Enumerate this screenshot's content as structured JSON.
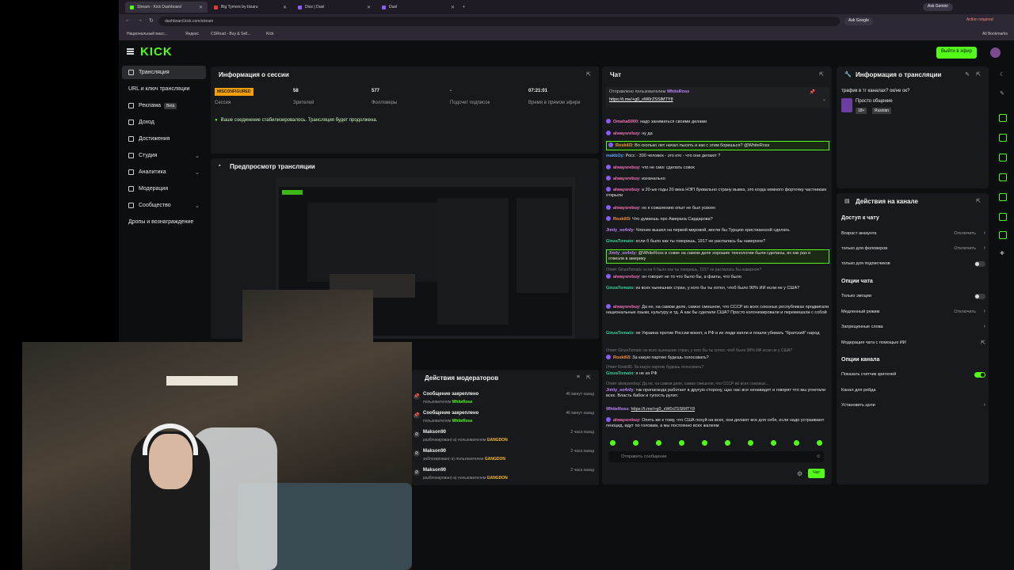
{
  "browser": {
    "tabs": [
      {
        "label": "Stream - Kick Dashboard",
        "active": true
      },
      {
        "label": "Big Tymers by bizaru",
        "active": false
      },
      {
        "label": "Dice | Duel",
        "active": false
      },
      {
        "label": "Duel",
        "active": false
      }
    ],
    "url": "dashboard.kick.com/stream",
    "bookmarks": [
      "Национальный масс...",
      "Яндекс",
      "CSRoad - Buy & Sell...",
      "Kick"
    ],
    "all_bookmarks": "All Bookmarks",
    "ask_search": "Ask Google",
    "gemini": "Ask Gemini",
    "action_required": "Action required"
  },
  "app": {
    "logo": "KICK",
    "go_live": "Выйти в эфир"
  },
  "sidebar": {
    "items": [
      {
        "label": "Трансляция",
        "active": true
      },
      {
        "label": "URL и ключ трансляции"
      },
      {
        "label": "Реклама",
        "badge": "Beta"
      },
      {
        "label": "Доход"
      },
      {
        "label": "Достижения"
      },
      {
        "label": "Студия",
        "expand": "⌄"
      },
      {
        "label": "Аналитика",
        "expand": "⌄"
      },
      {
        "label": "Модерация"
      },
      {
        "label": "Сообщество",
        "expand": "⌄"
      },
      {
        "label": "Дропы и вознаграждение"
      }
    ]
  },
  "session": {
    "title": "Информация о сессии",
    "badge": "MISCONFIGURED",
    "stats": [
      {
        "value": "",
        "label": "Сессия"
      },
      {
        "value": "58",
        "label": "Зрителей"
      },
      {
        "value": "577",
        "label": "Фолловеры"
      },
      {
        "value": "-",
        "label": "Подсчет подписок"
      },
      {
        "value": "07:21:01",
        "label": "Время в прямом эфире"
      }
    ],
    "stable_msg": "Ваше соединение стабилизировалось. Трансляция будет продолжена."
  },
  "preview": {
    "title": "Предпросмотр трансляции"
  },
  "mod_actions": {
    "title": "Действия модераторов",
    "rows": [
      {
        "title": "Сообщение закреплено",
        "sub": "пользователем",
        "user": "WhiteRoss",
        "time": "46 минут назад",
        "icon": "pin-icon"
      },
      {
        "title": "Сообщение закреплено",
        "sub": "пользователем",
        "user": "WhiteRoss",
        "time": "46 минут назад",
        "icon": "pin-icon"
      },
      {
        "title": "Makson90",
        "sub": "разблокирован(-а) пользователем",
        "user": "GANGDON",
        "time": "2 часа назад",
        "icon": "unban-icon"
      },
      {
        "title": "Makson90",
        "sub": "заблокирован(-а) пользователем",
        "user": "GANGDON",
        "time": "2 часа назад",
        "icon": "ban-icon"
      },
      {
        "title": "Makson90",
        "sub": "разблокирован(-а) пользователем",
        "user": "GANGDON",
        "time": "2 часа назад",
        "icon": "unban-icon"
      }
    ]
  },
  "chat": {
    "title": "Чат",
    "pinned_by": "Отправлено пользователем",
    "pinned_user": "WhiteRoss",
    "pinned_link": "https://t.me/+g0_xW0rZSSlMTY8",
    "input_placeholder": "Отправить сообщение",
    "send_label": "Чат",
    "messages": [
      {
        "user": "Omaha5000",
        "text": "надо заниматься своими делами",
        "color": "u-pink"
      },
      {
        "user": "alwaysrebuy",
        "text": "ну да",
        "color": "u-pink"
      },
      {
        "user": "Roskill3",
        "text": "Во сколько лет начал лысеть и как с этим боришься? @WhiteRoss",
        "color": "u-orange",
        "highlight": true
      },
      {
        "user": "makbOy",
        "text": "Росс - 300 человек - это кто - что они делают ?",
        "color": "u-blue"
      },
      {
        "user": "alwaysrebuy",
        "text": "что не смог сделать совок",
        "color": "u-pink"
      },
      {
        "user": "alwaysrebuy",
        "text": "изначально",
        "color": "u-pink"
      },
      {
        "user": "alwaysrebuy",
        "text": "в 20-ые годы 20 века НЭП буквально страну вывез, это когда немного форточку частникам открыли",
        "color": "u-pink"
      },
      {
        "user": "alwaysrebuy",
        "text": "но к сожалению опыт не был усвоен",
        "color": "u-pink"
      },
      {
        "user": "Roskill3",
        "text": "Что думаешь про Амирана Сардарова?",
        "color": "u-orange"
      },
      {
        "user": "Jimly_so4nly",
        "text": "Членин вышел на первой мировой, могли бы Турцию христианской сделать",
        "color": "u-purple"
      },
      {
        "user": "GinzaTomato",
        "text": "если б было как ты говоришь, 1917 не распалась бы наверное?",
        "color": "u-teal"
      },
      {
        "user": "Jimly_so4nly",
        "text": "@WhiteRoss в совке на самом деле хорошие технологии были сделаны, их как раз и отвезли в америку",
        "color": "u-purple",
        "highlight": true
      },
      {
        "reply": "Ответ GinzaTomato: если б было как ты говоришь, 1917 не распалась бы наверное?"
      },
      {
        "user": "alwaysrebuy",
        "text": "он говорит не то что было бы, а факты, что было",
        "color": "u-pink"
      },
      {
        "user": "GinzaTomato",
        "text": "из всех нынешних стран, у кого бы ты хотел, чтоб было 90% ИИ если не у США?",
        "color": "u-teal"
      },
      {
        "user": "alwaysrebuy",
        "text": "Да не, на самом деле, самое смешное, что СССР во всех союзных республиках продвигали национальные языки, культуру и тд. А как бы сделали США? Просто колонизировали и перемешали с собой",
        "color": "u-pink"
      },
      {
        "user": "GinzaTomato",
        "text": "не Украина против России воюет, а РФ и их люди взяли и пошли убивать \"братский\" народ",
        "color": "u-teal"
      },
      {
        "reply": "Ответ GinzaTomato: из всех нынешних стран, у кого бы ты хотел, чтоб было 90% ИИ если не у США?"
      },
      {
        "user": "Roskill3",
        "text": "За какую партию будешь голосовать?",
        "color": "u-orange"
      },
      {
        "reply": "Ответ Roskill3: За какую партию будешь голосовать?"
      },
      {
        "user": "GinzaTomato",
        "text": "я не из РФ",
        "color": "u-teal"
      },
      {
        "reply": "Ответ alwaysrebuy: Да не, на самом деле, самое смешное, что СССР во всех союзных..."
      },
      {
        "user": "Jimly_so4nly",
        "text": "так пропаганда работает в другую сторону, щас нас все ненавидят и говорят что мы угнетали всех. Власть бабок и тупость рулит.",
        "color": "u-purple"
      },
      {
        "user": "WhiteRoss",
        "text": "https://t.me/+g0_xW0rZSSlMTY8",
        "color": "u-purple"
      },
      {
        "user": "alwaysrebuy",
        "text": "Опять же к тому, что США похуй на всех, они делают все для себя, если надо устраивают геноцид, идут по головам, а мы постоянно всех жалеем",
        "color": "u-pink"
      }
    ]
  },
  "stream_info": {
    "title": "Информация о трансляции",
    "stream_title": "трафик в тг каналах? ок/не ок?",
    "category": "Просто общение",
    "tags": [
      "18+",
      "Russian"
    ]
  },
  "channel_actions": {
    "title": "Действия на канале",
    "access_head": "Доступ к чату",
    "access_rows": [
      {
        "label": "Возраст аккаунта",
        "value": "Отключить",
        "kind": "chev"
      },
      {
        "label": "только для фоловеров",
        "value": "Отключить",
        "kind": "chev"
      },
      {
        "label": "только для подписчиков",
        "value": "",
        "kind": "toggle",
        "on": false
      }
    ],
    "chat_opts_head": "Опции чата",
    "chat_opts": [
      {
        "label": "Только эмоции",
        "value": "",
        "kind": "toggle",
        "on": false
      },
      {
        "label": "Медленный режим",
        "value": "Отключить",
        "kind": "chev"
      },
      {
        "label": "Запрещенные слова",
        "value": "",
        "kind": "chev"
      },
      {
        "label": "Модерация чата с помощью ИИ",
        "value": "",
        "kind": "ext"
      }
    ],
    "channel_opts_head": "Опции канала",
    "channel_opts": [
      {
        "label": "Показать счетчик зрителей",
        "value": "",
        "kind": "toggle",
        "on": true
      },
      {
        "label": "Канал для рейда",
        "value": "",
        "kind": "none"
      },
      {
        "label": "Установить цели",
        "value": "",
        "kind": "chev"
      }
    ]
  }
}
